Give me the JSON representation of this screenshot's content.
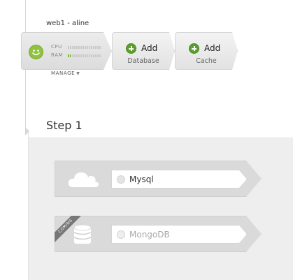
{
  "server": {
    "name": "web1 - aline",
    "metrics": [
      {
        "label": "CPU",
        "level": 0
      },
      {
        "label": "RAM",
        "level": 0.08
      }
    ],
    "manage_label": "MANAGE"
  },
  "actions": [
    {
      "title": "Add",
      "subtitle": "Database"
    },
    {
      "title": "Add",
      "subtitle": "Cache"
    }
  ],
  "step": {
    "title": "Step 1"
  },
  "services": [
    {
      "name": "Mysql",
      "icon": "cloud-icon",
      "status": "available"
    },
    {
      "name": "MongoDB",
      "icon": "database-icon",
      "status": "coming",
      "ribbon": "COMING"
    }
  ],
  "colors": {
    "accent_green": "#5aa02c",
    "smiley_green": "#8fc23e",
    "panel_bg": "#eeeeee"
  }
}
